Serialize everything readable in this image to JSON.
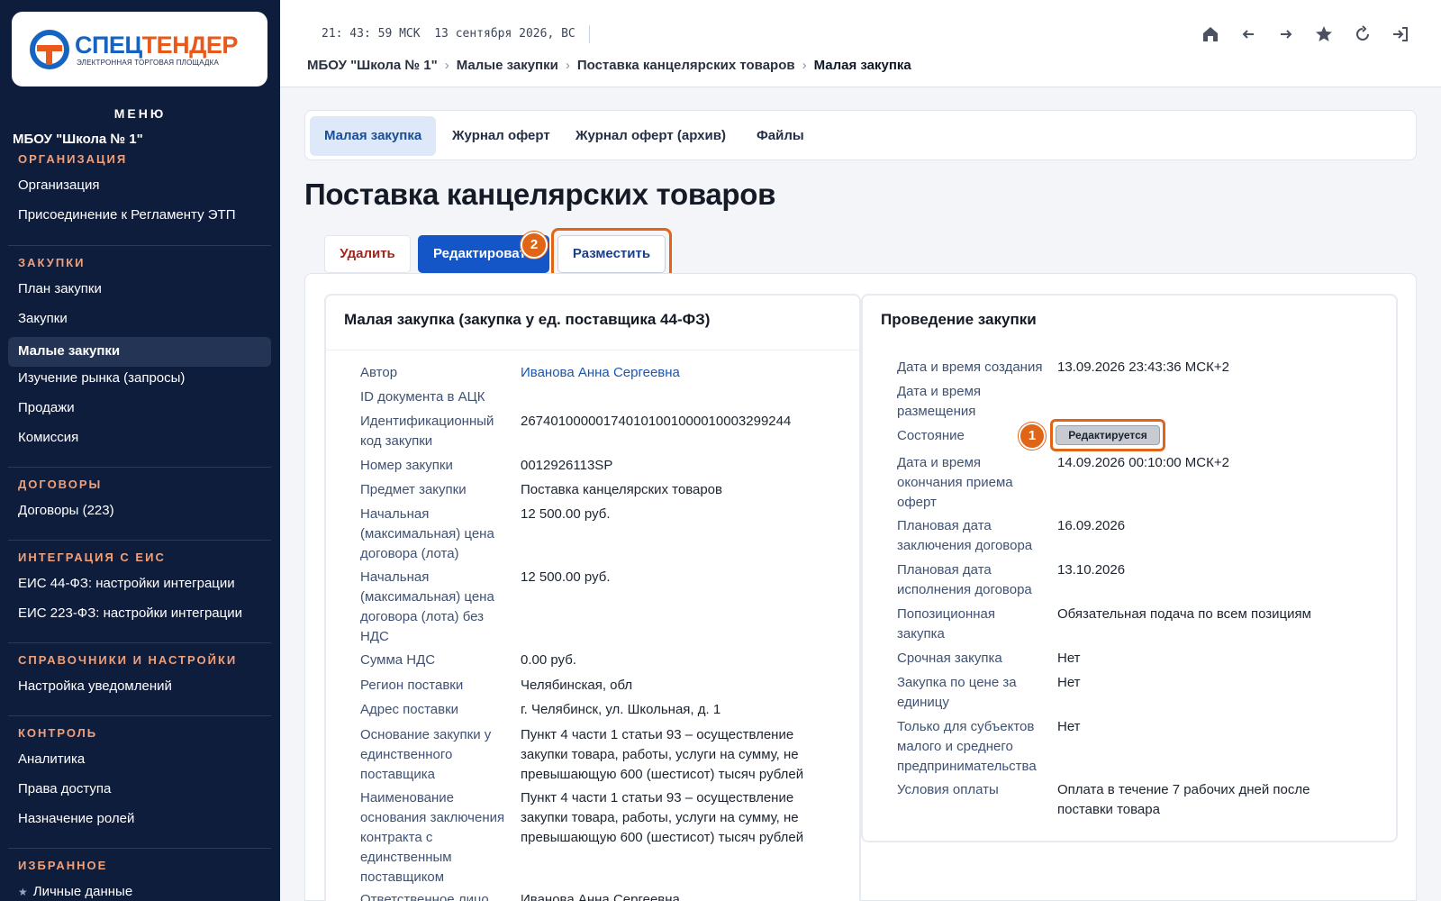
{
  "logo": {
    "name_part1": "СПЕЦ",
    "name_part2": "ТЕНДЕР",
    "subtitle": "ЭЛЕКТРОННАЯ ТОРГОВАЯ ПЛОЩАДКА"
  },
  "sidebar": {
    "menu_title": "МЕНЮ",
    "org_name": "МБОУ \"Школа № 1\"",
    "sections": [
      {
        "title": "ОРГАНИЗАЦИЯ",
        "items": [
          "Организация",
          "Присоединение к Регламенту ЭТП"
        ]
      },
      {
        "title": "ЗАКУПКИ",
        "items": [
          "План закупки",
          "Закупки",
          "Малые закупки",
          "Изучение рынка (запросы)",
          "Продажи",
          "Комиссия"
        ]
      },
      {
        "title": "ДОГОВОРЫ",
        "items": [
          "Договоры (223)"
        ]
      },
      {
        "title": "ИНТЕГРАЦИЯ С ЕИС",
        "items": [
          "ЕИС 44-ФЗ: настройки интеграции",
          "ЕИС 223-ФЗ: настройки интеграции"
        ]
      },
      {
        "title": "СПРАВОЧНИКИ И НАСТРОЙКИ",
        "items": [
          "Настройка уведомлений"
        ]
      },
      {
        "title": "КОНТРОЛЬ",
        "items": [
          "Аналитика",
          "Права доступа",
          "Назначение ролей"
        ]
      },
      {
        "title": "ИЗБРАННОЕ",
        "items": [
          "Личные данные"
        ]
      }
    ]
  },
  "header": {
    "clock": "21: 43: 59 МСК  13 сентября 2026, ВС",
    "breadcrumb": [
      "МБОУ \"Школа № 1\"",
      "Малые закупки",
      "Поставка канцелярских товаров",
      "Малая закупка"
    ],
    "icons": [
      "home-icon",
      "back-icon",
      "forward-icon",
      "star-icon",
      "refresh-icon",
      "logout-icon"
    ]
  },
  "tabs": [
    "Малая закупка",
    "Журнал оферт",
    "Журнал оферт (архив)",
    "Файлы"
  ],
  "page_title": "Поставка канцелярских товаров",
  "actions": {
    "delete": "Удалить",
    "edit": "Редактировать",
    "publish": "Разместить"
  },
  "steps": {
    "one": "1",
    "two": "2"
  },
  "left_card": {
    "title": "Малая закупка (закупка у ед. поставщика 44-ФЗ)",
    "rows": [
      {
        "label": "Автор",
        "value": "Иванова Анна Сергеевна"
      },
      {
        "label": "ID документа в АЦК",
        "value": ""
      },
      {
        "label": "Идентификационный код закупки",
        "value": "267401000001740101001000010003299244"
      },
      {
        "label": "Номер закупки",
        "value": "0012926113SP"
      },
      {
        "label": "Предмет закупки",
        "value": "Поставка канцелярских товаров"
      },
      {
        "label": "Начальная (максимальная) цена договора (лота)",
        "value": "12 500.00 руб."
      },
      {
        "label": "Начальная (максимальная) цена договора (лота) без НДС",
        "value": "12 500.00 руб."
      },
      {
        "label": "Сумма НДС",
        "value": "0.00 руб."
      },
      {
        "label": "Регион поставки",
        "value": "Челябинская, обл"
      },
      {
        "label": "Адрес поставки",
        "value": "г. Челябинск, ул. Школьная, д. 1"
      },
      {
        "label": "Основание закупки у единственного поставщика",
        "value": "Пункт 4 части 1 статьи 93 – осуществление закупки товара, работы, услуги на сумму, не превышающую 600 (шестисот) тысяч рублей"
      },
      {
        "label": "Наименование основания заключения контракта с единственным поставщиком",
        "value": "Пункт 4 части 1 статьи 93 – осуществление закупки товара, работы, услуги на сумму, не превышающую 600 (шестисот) тысяч рублей"
      },
      {
        "label": "Ответственное лицо",
        "value": "Иванова Анна Сергеевна"
      }
    ]
  },
  "right_card": {
    "title": "Проведение закупки",
    "rows": [
      {
        "label": "Дата и время создания",
        "value": "13.09.2026 23:43:36 МСК+2"
      },
      {
        "label": "Дата и время размещения",
        "value": ""
      },
      {
        "label": "Состояние",
        "value": "Редактируется"
      },
      {
        "label": "Дата и время окончания приема оферт",
        "value": "14.09.2026 00:10:00 МСК+2"
      },
      {
        "label": "Плановая дата заключения договора",
        "value": "16.09.2026"
      },
      {
        "label": "Плановая дата исполнения договора",
        "value": "13.10.2026"
      },
      {
        "label": "Попозиционная закупка",
        "value": "Обязательная подача по всем позициям"
      },
      {
        "label": "Срочная закупка",
        "value": "Нет"
      },
      {
        "label": "Закупка по цене за единицу",
        "value": "Нет"
      },
      {
        "label": "Только для субъектов малого и среднего предпринимательства",
        "value": "Нет"
      },
      {
        "label": "Условия оплаты",
        "value": "Оплата в течение 7 рабочих дней после поставки товара"
      }
    ]
  },
  "colors": {
    "sidebar_bg": "#0f1d3c",
    "accent": "#1456c8",
    "highlight": "#e06517",
    "section_title": "#f0a07a"
  }
}
